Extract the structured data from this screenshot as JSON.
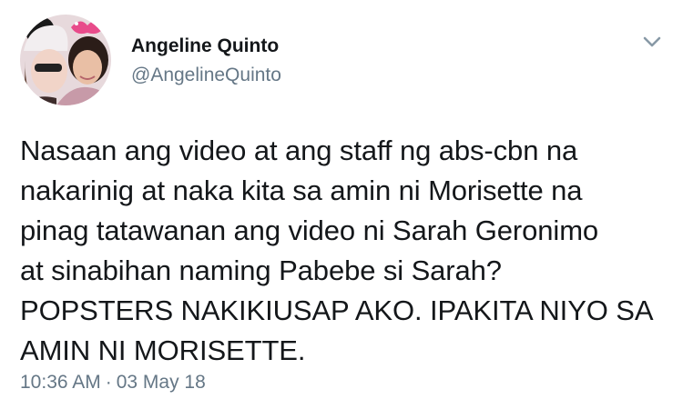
{
  "tweet": {
    "author": {
      "display_name": "Angeline Quinto",
      "handle": "@AngelineQuinto",
      "avatar_icon": "profile-photo"
    },
    "menu_icon": "chevron-down-icon",
    "text": "Nasaan ang video at ang staff ng abs-cbn na\nnakarinig at naka kita sa amin ni Morisette na\npinag tatawanan ang video ni Sarah Geronimo\nat sinabihan naming Pabebe si Sarah?\nPOPSTERS NAKIKIUSAP AKO. IPAKITA NIYO SA\nAMIN NI MORISETTE.",
    "time": "10:36 AM",
    "separator": "·",
    "date": "03 May 18"
  },
  "colors": {
    "text": "#14171a",
    "secondary": "#657786",
    "background": "#ffffff"
  }
}
